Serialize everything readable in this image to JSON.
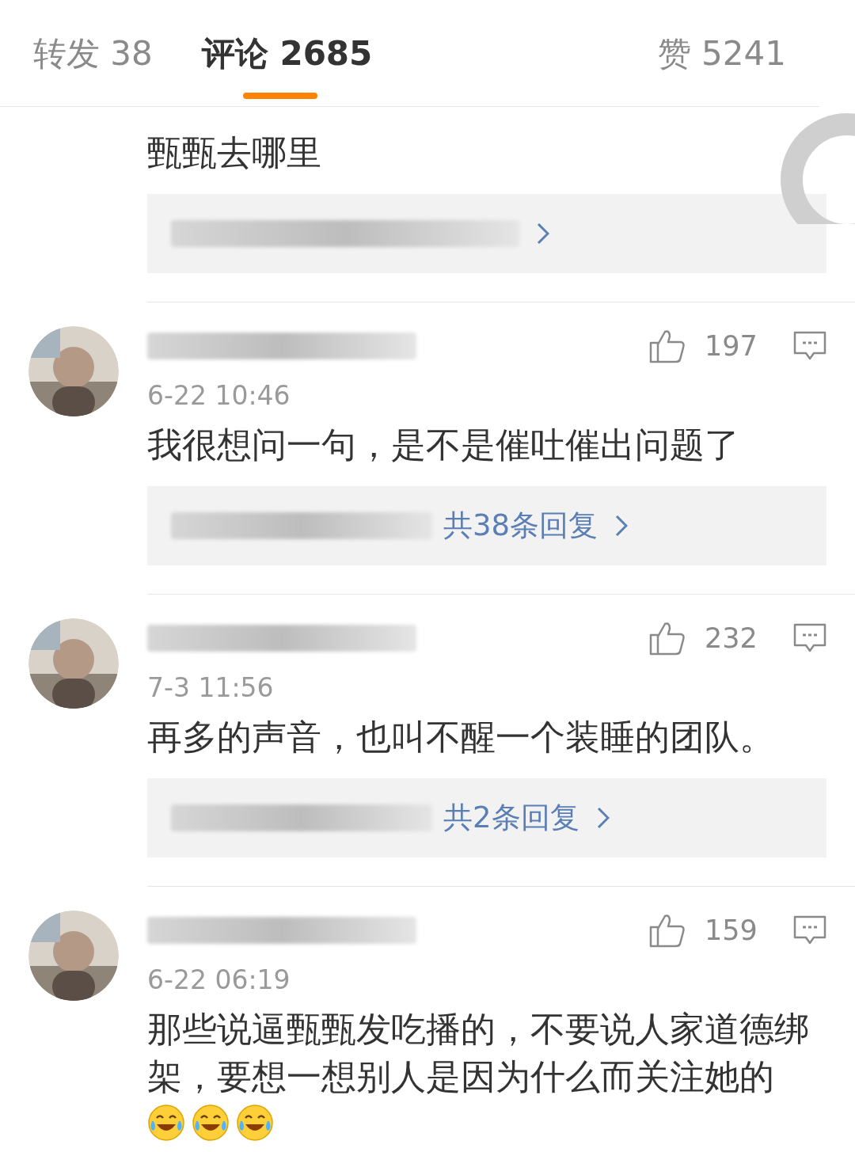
{
  "tabs": [
    {
      "label": "转发 38",
      "selected": false
    },
    {
      "label": "评论 2685",
      "selected": true
    },
    {
      "label": "赞 5241",
      "selected": false
    }
  ],
  "comments": [
    {
      "kind": "cut_off",
      "text": "甄甄去哪里",
      "reply_summary": {
        "kind": "names_only"
      }
    },
    {
      "kind": "full",
      "date": "6-22 10:46",
      "likes": "197",
      "text": "我很想问一句，是不是催吐催出问题了",
      "reply_summary": {
        "kind": "with_count",
        "text": "共38条回复"
      }
    },
    {
      "kind": "full",
      "date": "7-3 11:56",
      "likes": "232",
      "text": "再多的声音，也叫不醒一个装睡的团队。",
      "reply_summary": {
        "kind": "with_count",
        "text": "共2条回复"
      }
    },
    {
      "kind": "full",
      "date": "6-22 06:19",
      "likes": "159",
      "text": "那些说逼甄甄发吃播的，不要说人家道德绑架，要想一想别人是因为什么而关注她的",
      "emojis": [
        {
          "kind": "laugh_cry"
        },
        {
          "kind": "laugh_cry"
        },
        {
          "kind": "laugh_cry"
        }
      ]
    }
  ]
}
